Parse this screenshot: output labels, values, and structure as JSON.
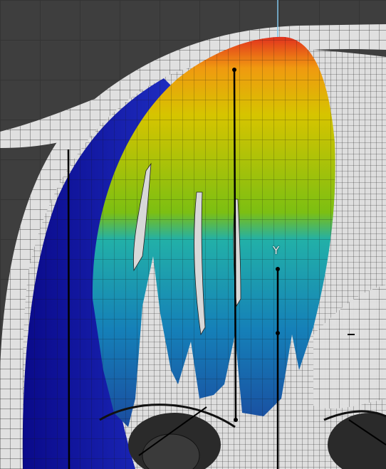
{
  "viewport": {
    "axis_label": "Y",
    "mode": "Weight Paint",
    "colors": {
      "background": "#3e3e3e",
      "grid": "#343434",
      "mesh": "#e4e4e4",
      "wire": "#2a2a2a",
      "weight_low": "#1a1aa8",
      "weight_mid": "#19b4b4",
      "weight_high_mid": "#c9d200",
      "weight_high": "#e2321e"
    }
  }
}
